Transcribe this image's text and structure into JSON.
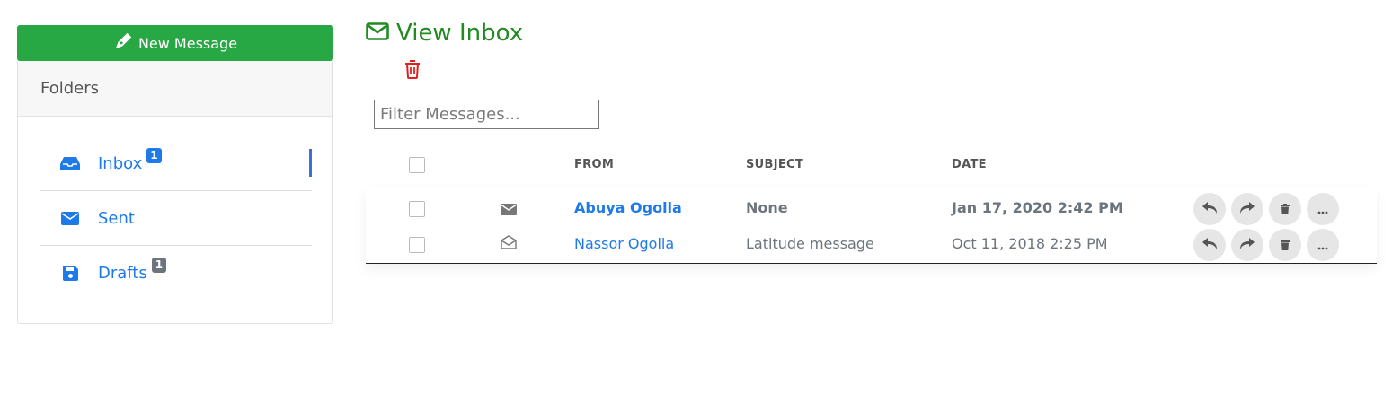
{
  "sidebar": {
    "new_message_label": "New Message",
    "folders_title": "Folders",
    "folders": [
      {
        "label": "Inbox",
        "badge": "1",
        "icon": "inbox-icon",
        "active": true
      },
      {
        "label": "Sent",
        "badge": "",
        "icon": "envelope-icon",
        "active": false
      },
      {
        "label": "Drafts",
        "badge": "1",
        "icon": "floppy-icon",
        "active": false
      }
    ]
  },
  "main": {
    "title": "View Inbox",
    "filter_placeholder": "Filter Messages...",
    "columns": {
      "from": "FROM",
      "subject": "SUBJECT",
      "date": "DATE"
    },
    "messages": [
      {
        "from": "Abuya Ogolla",
        "subject": "None",
        "date": "Jan 17, 2020 2:42 PM",
        "unread": true,
        "icon": "envelope-closed-icon"
      },
      {
        "from": "Nassor Ogolla",
        "subject": "Latitude message",
        "date": "Oct 11, 2018 2:25 PM",
        "unread": false,
        "icon": "envelope-open-icon"
      }
    ]
  },
  "colors": {
    "primary_green": "#28a745",
    "title_green": "#218a21",
    "link_blue": "#1e7ae8",
    "danger_red": "#e02020"
  }
}
